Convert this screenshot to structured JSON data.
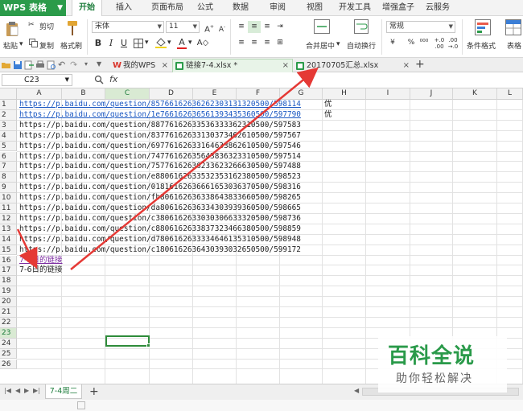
{
  "app": {
    "name": "WPS 表格"
  },
  "menu_tabs": [
    "开始",
    "插入",
    "页面布局",
    "公式",
    "数据",
    "审阅",
    "视图",
    "开发工具",
    "增强盒子",
    "云服务"
  ],
  "ribbon": {
    "paste": "粘贴",
    "cut": "剪切",
    "copy": "复制",
    "format_painter": "格式刷",
    "font_name": "宋体",
    "font_size": "11",
    "bold": "B",
    "italic": "I",
    "underline": "U",
    "merge_center": "合并居中",
    "wrap_text": "自动换行",
    "number_format": "常规",
    "percent": "%",
    "conditional_format": "条件格式",
    "table_style": "表格"
  },
  "doc_tabs": [
    {
      "label": "我的WPS"
    },
    {
      "label": "链接7-4.xlsx *"
    },
    {
      "label": "20170705汇总.xlsx"
    }
  ],
  "formula_bar": {
    "name_box": "C23",
    "fx": "fx"
  },
  "columns": [
    "A",
    "B",
    "C",
    "D",
    "E",
    "F",
    "G",
    "H",
    "I",
    "J",
    "K",
    "L"
  ],
  "rows": [
    "1",
    "2",
    "3",
    "4",
    "5",
    "6",
    "7",
    "8",
    "9",
    "10",
    "11",
    "12",
    "13",
    "14",
    "15",
    "16",
    "17",
    "18",
    "19",
    "20",
    "21",
    "22",
    "23",
    "24",
    "25",
    "26"
  ],
  "cells": [
    {
      "text": "https://p.baidu.com/question/85766162636262303131320500/598114",
      "style": "link"
    },
    {
      "text": "https://p.baidu.com/question/1e766162636561393435360500/597790",
      "style": "link"
    },
    {
      "text": "https://p.baidu.com/question/88776162633536333362310500/597583",
      "style": "plain"
    },
    {
      "text": "https://p.baidu.com/question/83776162633130373462610500/597567",
      "style": "plain"
    },
    {
      "text": "https://p.baidu.com/question/69776162633164633862610500/597546",
      "style": "plain"
    },
    {
      "text": "https://p.baidu.com/question/74776162635643836323310500/597514",
      "style": "plain"
    },
    {
      "text": "https://p.baidu.com/question/75776162636233623266630500/597488",
      "style": "plain"
    },
    {
      "text": "https://p.baidu.com/question/e8806162633532353162380500/598523",
      "style": "plain"
    },
    {
      "text": "https://p.baidu.com/question/01816162636661653036370500/598316",
      "style": "plain"
    },
    {
      "text": "https://p.baidu.com/question/fb806162636338643833660500/598265",
      "style": "plain"
    },
    {
      "text": "https://p.baidu.com/question/da806162636334303939360500/598665",
      "style": "plain"
    },
    {
      "text": "https://p.baidu.com/question/c3806162633030306633320500/598736",
      "style": "plain"
    },
    {
      "text": "https://p.baidu.com/question/c8806162633837323466380500/598859",
      "style": "plain"
    },
    {
      "text": "https://p.baidu.com/question/d7806162633334646135310500/598948",
      "style": "plain"
    },
    {
      "text": "https://p.baidu.com/question/c1806162636430393032650500/599172",
      "style": "plain"
    },
    {
      "text": "7-5日的链接",
      "style": "visited"
    },
    {
      "text": "7-6日的链接",
      "style": "cjk"
    }
  ],
  "h_column": [
    "优",
    "优"
  ],
  "selected_cell": "C23",
  "sheet_tab": "7-4周二",
  "watermark": {
    "title": "百科全说",
    "subtitle": "助你轻松解决"
  },
  "colors": {
    "accent": "#2b9b4a",
    "link": "#1a57c2",
    "visited": "#7b2aa0",
    "arrow": "#e53935"
  }
}
